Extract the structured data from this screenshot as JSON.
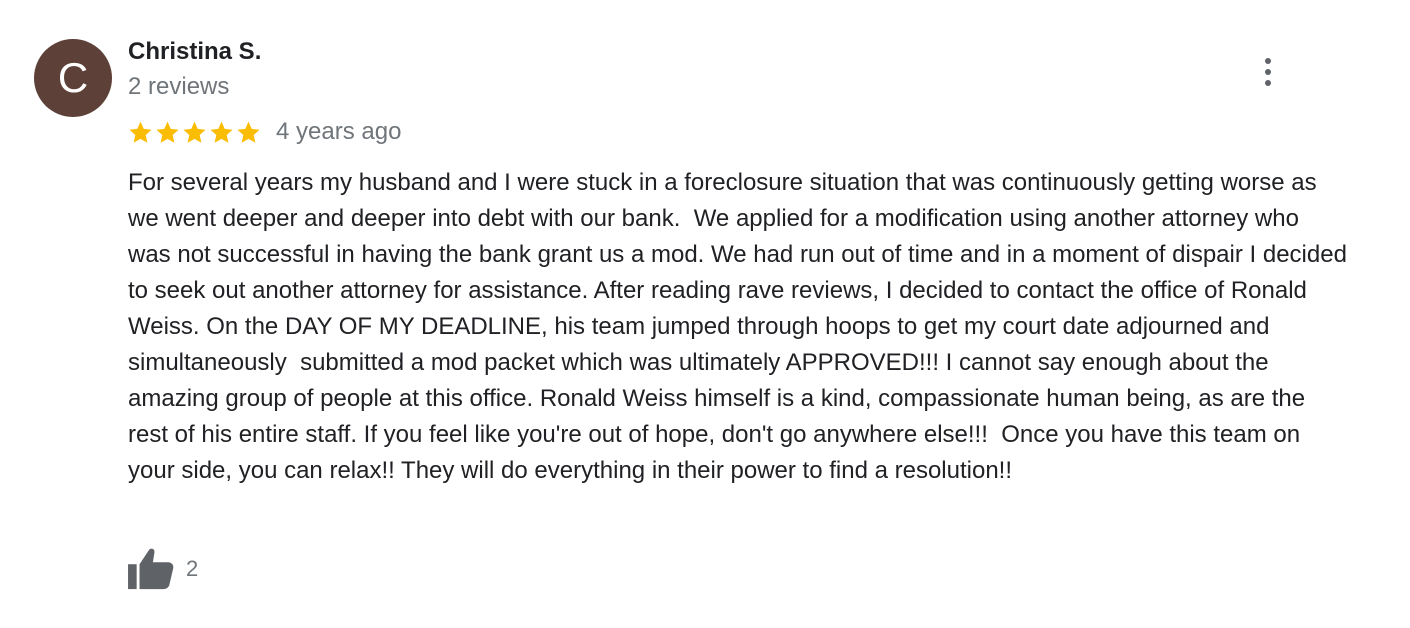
{
  "reviewer": {
    "initial": "C",
    "name": "Christina S.",
    "review_count": "2 reviews",
    "avatar_color": "#5d4037"
  },
  "review": {
    "rating": 5,
    "rating_max": 5,
    "star_color": "#fbbc04",
    "date": "4 years ago",
    "text": "For several years my husband and I were stuck in a foreclosure situation that was continuously getting worse as we went deeper and deeper into debt with our bank.  We applied for a modification using another attorney who was not successful in having the bank grant us a mod. We had run out of time and in a moment of dispair I decided to seek out another attorney for assistance. After reading rave reviews, I decided to contact the office of Ronald Weiss. On the DAY OF MY DEADLINE, his team jumped through hoops to get my court date adjourned and simultaneously  submitted a mod packet which was ultimately APPROVED!!! I cannot say enough about the amazing group of people at this office. Ronald Weiss himself is a kind, compassionate human being, as are the rest of his entire staff. If you feel like you're out of hope, don't go anywhere else!!!  Once you have this team on your side, you can relax!! They will do everything in their power to find a resolution!!"
  },
  "actions": {
    "like_count": "2",
    "like_icon": "thumbs-up-icon",
    "more_icon": "more-vert-icon"
  }
}
